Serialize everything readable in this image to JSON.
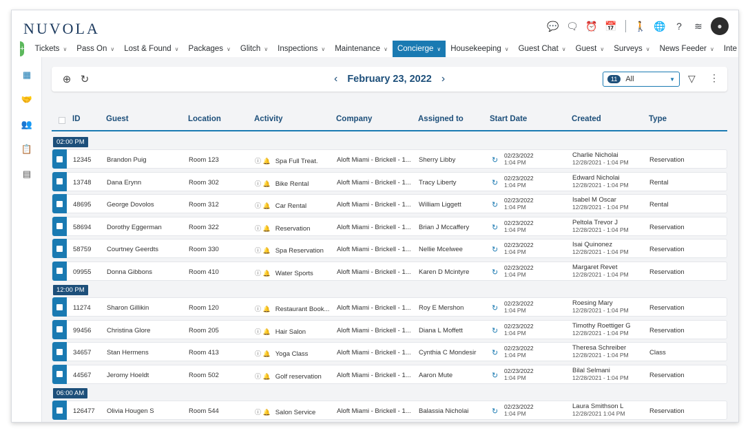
{
  "app": {
    "logo": "NUVOLA",
    "avatar_initial": "●"
  },
  "top_icons": [
    {
      "name": "chat-bubble-icon",
      "glyph": "💬"
    },
    {
      "name": "message-icon",
      "glyph": "🗨"
    },
    {
      "name": "alarm-clock-icon",
      "glyph": "⏰"
    },
    {
      "name": "calendar-icon",
      "glyph": "📅"
    },
    {
      "name": "walk-icon",
      "glyph": "🚶"
    },
    {
      "name": "globe-icon",
      "glyph": "🌐"
    },
    {
      "name": "help-icon",
      "glyph": "?"
    },
    {
      "name": "settings-sliders-icon",
      "glyph": "≋"
    }
  ],
  "nav": {
    "items": [
      {
        "label": "Tickets",
        "active": false
      },
      {
        "label": "Pass On",
        "active": false
      },
      {
        "label": "Lost & Found",
        "active": false
      },
      {
        "label": "Packages",
        "active": false
      },
      {
        "label": "Glitch",
        "active": false
      },
      {
        "label": "Inspections",
        "active": false
      },
      {
        "label": "Maintenance",
        "active": false
      },
      {
        "label": "Concierge",
        "active": true
      },
      {
        "label": "Housekeeping",
        "active": false
      },
      {
        "label": "Guest Chat",
        "active": false
      },
      {
        "label": "Guest",
        "active": false
      },
      {
        "label": "Surveys",
        "active": false
      },
      {
        "label": "News Feeder",
        "active": false
      },
      {
        "label": "Inte",
        "active": false
      }
    ]
  },
  "sidebar": {
    "icons": [
      "calendar-grid-icon",
      "handshake-icon",
      "people-icon",
      "clipboard-icon",
      "document-icon"
    ]
  },
  "toolbar": {
    "date": "February 23, 2022",
    "filter_count": "11",
    "filter_value": "All"
  },
  "table": {
    "headers": {
      "id": "ID",
      "guest": "Guest",
      "location": "Location",
      "activity": "Activity",
      "company": "Company",
      "assigned": "Assigned to",
      "start": "Start Date",
      "created": "Created",
      "type": "Type"
    },
    "groups": [
      {
        "time": "02:00 PM",
        "rows": [
          {
            "id": "12345",
            "guest": "Brandon Puig",
            "location": "Room 123",
            "activity": "Spa Full Treat.",
            "company": "Aloft Miami - Brickell - 1...",
            "assigned": "Sherry Libby",
            "start_date": "02/23/2022",
            "start_time": "1:04 PM",
            "created_by": "Charlie Nicholai",
            "created_at": "12/28/2021 - 1:04 PM",
            "type": "Reservation"
          },
          {
            "id": "13748",
            "guest": "Dana Erynn",
            "location": "Room 302",
            "activity": "Bike Rental",
            "company": "Aloft Miami - Brickell - 1...",
            "assigned": "Tracy Liberty",
            "start_date": "02/23/2022",
            "start_time": "1:04 PM",
            "created_by": "Edward Nicholai",
            "created_at": "12/28/2021 - 1:04 PM",
            "type": "Rental"
          },
          {
            "id": "48695",
            "guest": "George Dovolos",
            "location": "Room 312",
            "activity": "Car Rental",
            "company": "Aloft Miami - Brickell - 1...",
            "assigned": "William Liggett",
            "start_date": "02/23/2022",
            "start_time": "1:04 PM",
            "created_by": "Isabel M Oscar",
            "created_at": "12/28/2021 - 1:04 PM",
            "type": "Rental"
          },
          {
            "id": "58694",
            "guest": "Dorothy Eggerman",
            "location": "Room 322",
            "activity": "Reservation",
            "company": "Aloft Miami - Brickell - 1...",
            "assigned": "Brian J Mccaffery",
            "start_date": "02/23/2022",
            "start_time": "1:04 PM",
            "created_by": "Peltola Trevor J",
            "created_at": "12/28/2021 - 1:04 PM",
            "type": "Reservation"
          },
          {
            "id": "58759",
            "guest": "Courtney Geerdts",
            "location": "Room 330",
            "activity": "Spa Reservation",
            "company": "Aloft Miami - Brickell - 1...",
            "assigned": "Nellie Mcelwee",
            "start_date": "02/23/2022",
            "start_time": "1:04 PM",
            "created_by": "Isai Quinonez",
            "created_at": "12/28/2021 - 1:04 PM",
            "type": "Reservation"
          },
          {
            "id": "09955",
            "guest": "Donna Gibbons",
            "location": "Room 410",
            "activity": "Water Sports",
            "company": "Aloft Miami - Brickell - 1...",
            "assigned": "Karen D Mcintyre",
            "start_date": "02/23/2022",
            "start_time": "1:04 PM",
            "created_by": "Margaret Revet",
            "created_at": "12/28/2021 - 1:04 PM",
            "type": "Reservation"
          }
        ]
      },
      {
        "time": "12:00 PM",
        "rows": [
          {
            "id": "11274",
            "guest": "Sharon Gillikin",
            "location": "Room 120",
            "activity": "Restaurant Book...",
            "company": "Aloft Miami - Brickell - 1...",
            "assigned": "Roy E Mershon",
            "start_date": "02/23/2022",
            "start_time": "1:04 PM",
            "created_by": "Roesing Mary",
            "created_at": "12/28/2021 - 1:04 PM",
            "type": "Reservation"
          },
          {
            "id": "99456",
            "guest": "Christina Glore",
            "location": "Room 205",
            "activity": "Hair Salon",
            "company": "Aloft Miami - Brickell - 1...",
            "assigned": "Diana L Moffett",
            "start_date": "02/23/2022",
            "start_time": "1:04 PM",
            "created_by": "Timothy Roettiger G",
            "created_at": "12/28/2021 - 1:04 PM",
            "type": "Reservation"
          },
          {
            "id": "34657",
            "guest": "Stan Hermens",
            "location": "Room 413",
            "activity": "Yoga Class",
            "company": "Aloft Miami - Brickell - 1...",
            "assigned": "Cynthia C Mondesir",
            "start_date": "02/23/2022",
            "start_time": "1:04 PM",
            "created_by": "Theresa Schreiber",
            "created_at": "12/28/2021 - 1:04 PM",
            "type": "Class"
          },
          {
            "id": "44567",
            "guest": "Jeromy Hoeldt",
            "location": "Room 502",
            "activity": "Golf reservation",
            "company": "Aloft Miami - Brickell - 1...",
            "assigned": "Aaron Mute",
            "start_date": "02/23/2022",
            "start_time": "1:04 PM",
            "created_by": "Bilal Selmani",
            "created_at": "12/28/2021 - 1:04 PM",
            "type": "Reservation"
          }
        ]
      },
      {
        "time": "06:00 AM",
        "rows": [
          {
            "id": "126477",
            "guest": "Olivia Hougen S",
            "location": "Room 544",
            "activity": "Salon Service",
            "company": "Aloft Miami - Brickell - 1...",
            "assigned": "Balassia Nicholai",
            "start_date": "02/23/2022",
            "start_time": "1:04 PM",
            "created_by": "Laura Smithson L",
            "created_at": "12/28/2021 1:04 PM",
            "type": "Reservation"
          }
        ]
      }
    ]
  },
  "colors": {
    "accent": "#1a7ab2",
    "heading": "#1d4f7a",
    "plus": "#5cb85c"
  }
}
